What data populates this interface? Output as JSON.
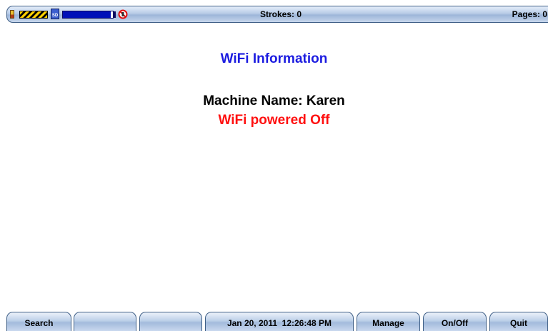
{
  "status_bar": {
    "strokes": "Strokes: 0",
    "pages": "Pages: 0",
    "sd_label": "SD",
    "storage_level": 0.95,
    "icons": [
      "battery-icon",
      "hazard-stripe-icon",
      "sd-card-icon",
      "storage-progress-bar",
      "no-signal-icon"
    ]
  },
  "main": {
    "title": "WiFi Information",
    "machine_name": "Machine Name: Karen",
    "wifi_status": "WiFi powered Off"
  },
  "colors": {
    "title": "#1c1ce0",
    "wifi_status": "#ff1010",
    "storage_fill": "#0010b8"
  },
  "softkeys": [
    {
      "label": "Search"
    },
    {
      "label": ""
    },
    {
      "label": ""
    },
    {
      "label": "Jan 20, 2011  12:26:48 PM"
    },
    {
      "label": "Manage"
    },
    {
      "label": "On/Off"
    },
    {
      "label": "Quit"
    }
  ]
}
